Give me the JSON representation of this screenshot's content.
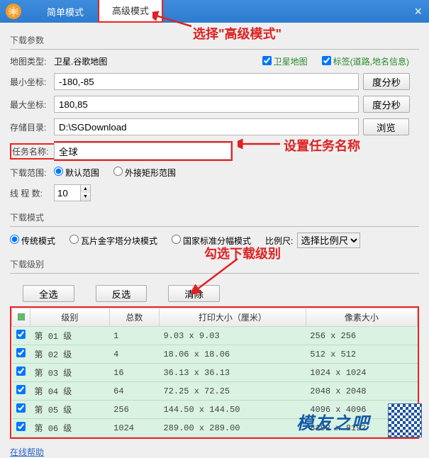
{
  "titlebar": {
    "tabs": {
      "simple": "简单模式",
      "advanced": "高级模式"
    },
    "close": "×"
  },
  "annotations": {
    "select_adv": "选择\"高级模式\"",
    "set_task_name": "设置任务名称",
    "check_levels": "勾选下载级别"
  },
  "download_params": {
    "title": "下载参数",
    "map_type_label": "地图类型:",
    "map_type_value": "卫星.谷歌地图",
    "sat_map": "卫星地图",
    "labels": "标签(道路,地名信息)",
    "min_coord_label": "最小坐标:",
    "min_coord_value": "-180,-85",
    "max_coord_label": "最大坐标:",
    "max_coord_value": "180,85",
    "dms_btn": "度分秒",
    "store_label": "存储目录:",
    "store_value": "D:\\SGDownload",
    "browse_btn": "浏览",
    "task_label": "任务名称:",
    "task_value": "全球",
    "range_label": "下载范围:",
    "range_default": "默认范围",
    "range_bbox": "外接矩形范围",
    "threads_label": "线 程 数:",
    "threads_value": "10"
  },
  "download_mode": {
    "title": "下载模式",
    "trad": "传统模式",
    "pyramid": "瓦片金字塔分块模式",
    "national": "国家标准分幅模式",
    "scale_label": "比例尺:",
    "scale_value": "选择比例尺"
  },
  "download_level": {
    "title": "下载级别",
    "btn_all": "全选",
    "btn_inv": "反选",
    "btn_clr": "清除",
    "headers": {
      "level": "级别",
      "total": "总数",
      "print": "打印大小（厘米）",
      "pixels": "像素大小"
    },
    "rows": [
      {
        "checked": true,
        "level": "第 01 级",
        "total": "1",
        "print": "9.03 x 9.03",
        "pixels": "256 x 256"
      },
      {
        "checked": true,
        "level": "第 02 级",
        "total": "4",
        "print": "18.06 x 18.06",
        "pixels": "512 x 512"
      },
      {
        "checked": true,
        "level": "第 03 级",
        "total": "16",
        "print": "36.13 x 36.13",
        "pixels": "1024 x 1024"
      },
      {
        "checked": true,
        "level": "第 04 级",
        "total": "64",
        "print": "72.25 x 72.25",
        "pixels": "2048 x 2048"
      },
      {
        "checked": true,
        "level": "第 05 级",
        "total": "256",
        "print": "144.50 x 144.50",
        "pixels": "4096 x 4096"
      },
      {
        "checked": true,
        "level": "第 06 级",
        "total": "1024",
        "print": "289.00 x 289.00",
        "pixels": "8192 x 8192"
      }
    ]
  },
  "footer": {
    "help": "在线帮助",
    "brand": "模友之吧"
  }
}
